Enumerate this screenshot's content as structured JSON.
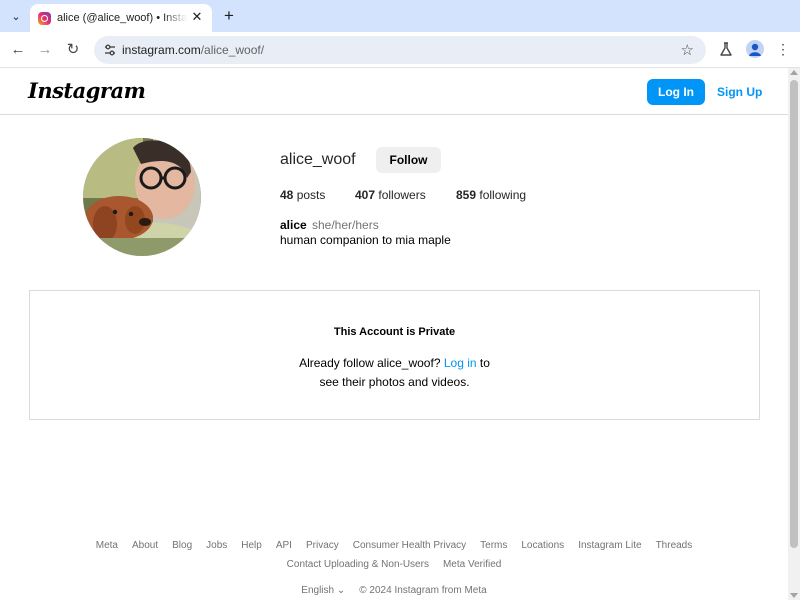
{
  "browser": {
    "tab_title": "alice (@alice_woof) • Instagram photos and videos",
    "url_domain": "instagram.com",
    "url_path": "/alice_woof/"
  },
  "header": {
    "logo": "Instagram",
    "login_label": "Log In",
    "signup_label": "Sign Up",
    "accent": "#0095f6"
  },
  "profile": {
    "username": "alice_woof",
    "follow_label": "Follow",
    "posts_count": "48",
    "posts_label": "posts",
    "followers_count": "407",
    "followers_label": "followers",
    "following_count": "859",
    "following_label": "following",
    "full_name": "alice",
    "pronouns": "she/her/hers",
    "bio": "human companion to mia maple"
  },
  "private": {
    "title": "This Account is Private",
    "line1_before": "Already follow alice_woof?",
    "login_link": "Log in",
    "line1_after": "to",
    "line2": "see their photos and videos."
  },
  "footer": {
    "links": [
      "Meta",
      "About",
      "Blog",
      "Jobs",
      "Help",
      "API",
      "Privacy",
      "Consumer Health Privacy",
      "Terms",
      "Locations",
      "Instagram Lite",
      "Threads",
      "Contact Uploading & Non-Users",
      "Meta Verified"
    ],
    "language": "English",
    "copyright": "© 2024 Instagram from Meta"
  }
}
